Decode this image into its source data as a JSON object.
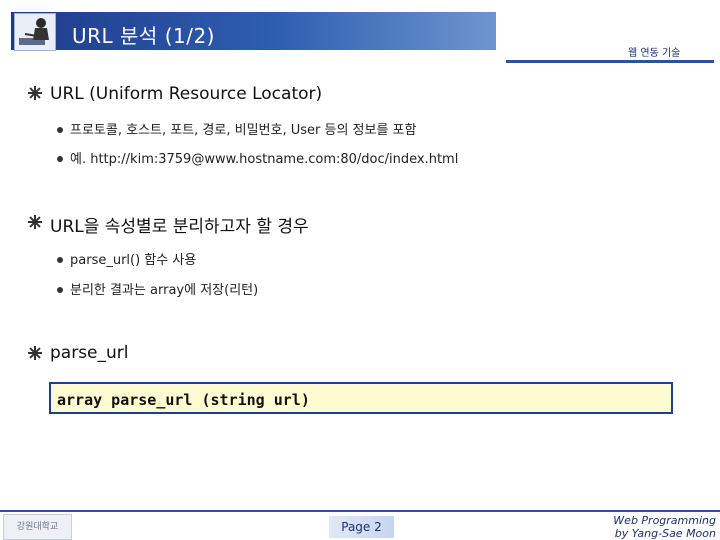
{
  "header": {
    "title": "URL 분석 (1/2)",
    "top_right": "웹 연동 기술"
  },
  "sections": [
    {
      "heading": "URL (Uniform Resource Locator)",
      "items": [
        "프로토콜, 호스트, 포트, 경로, 비밀번호, User 등의 정보를 포함",
        "예. http://kim:3759@www.hostname.com:80/doc/index.html"
      ]
    },
    {
      "heading": "URL을 속성별로 분리하고자 할 경우",
      "items": [
        "parse_url() 함수 사용",
        "분리한 결과는 array에 저장(리턴)"
      ]
    },
    {
      "heading": "parse_url",
      "items": []
    }
  ],
  "code": "array parse_url (string url)",
  "footer": {
    "page": "Page 2",
    "credit_line1": "Web Programming",
    "credit_line2": "by Yang-Sae Moon",
    "logo_text": "강원대학교"
  },
  "colors": {
    "accent": "#1d3f8f",
    "code_bg": "#fffbd0"
  }
}
